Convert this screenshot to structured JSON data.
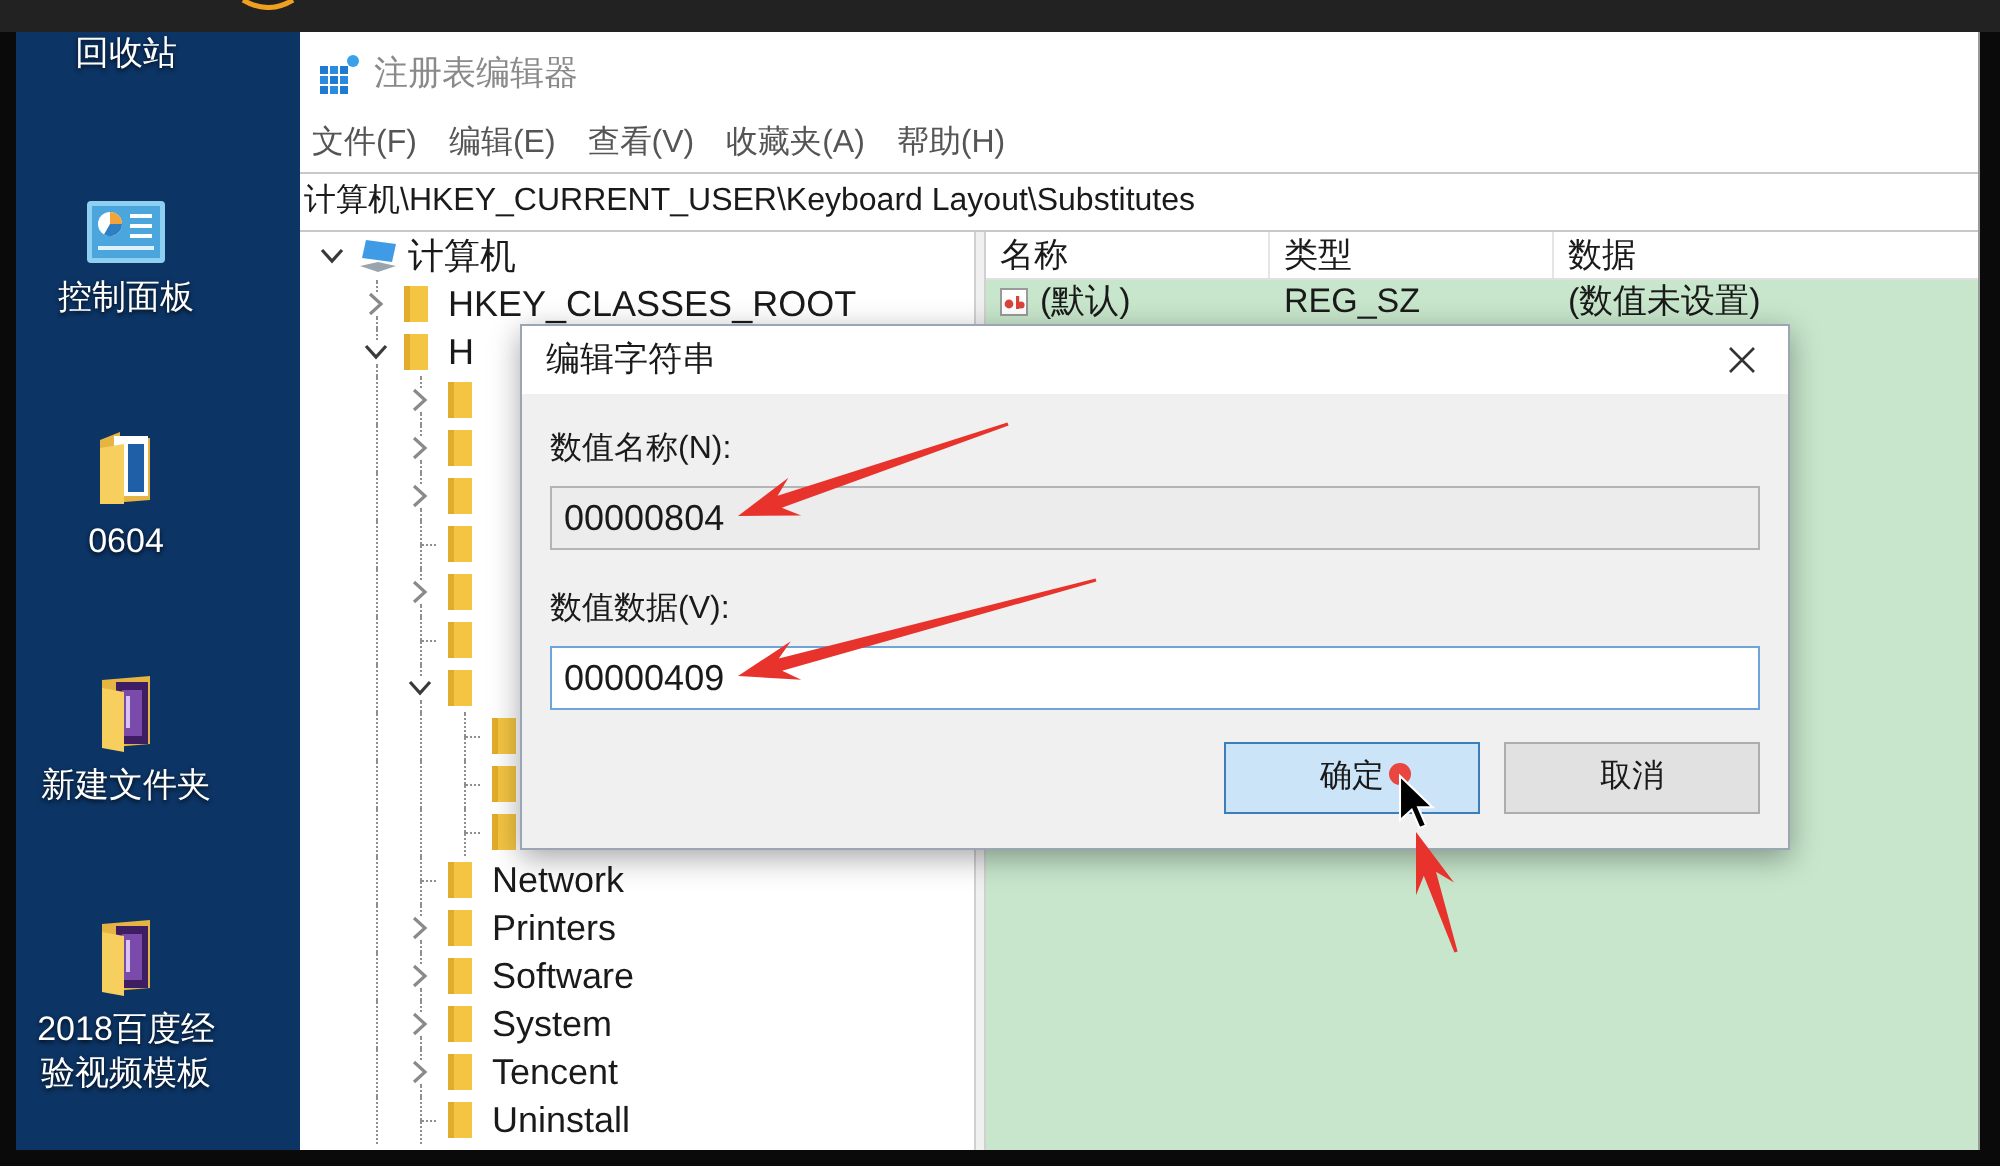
{
  "desktop": {
    "icons": [
      {
        "label": "回收站",
        "kind": "none"
      },
      {
        "label": "控制面板",
        "kind": "panel"
      },
      {
        "label": "0604",
        "kind": "document_folder"
      },
      {
        "label": "新建文件夹",
        "kind": "book_folder"
      },
      {
        "label": "2018百度经验视频模板",
        "kind": "book_folder"
      }
    ]
  },
  "window": {
    "title": "注册表编辑器",
    "menu": [
      "文件(F)",
      "编辑(E)",
      "查看(V)",
      "收藏夹(A)",
      "帮助(H)"
    ],
    "address": "计算机\\HKEY_CURRENT_USER\\Keyboard Layout\\Substitutes"
  },
  "tree": [
    {
      "label": "计算机",
      "kind": "computer",
      "expanded": true,
      "children": [
        {
          "label": "HKEY_CLASSES_ROOT",
          "kind": "folder",
          "expanded": false
        },
        {
          "label": "H",
          "kind": "folder",
          "expanded": true,
          "children": [
            {
              "kind": "folder",
              "expanded": false
            },
            {
              "kind": "folder",
              "expanded": false
            },
            {
              "kind": "folder",
              "expanded": false
            },
            {
              "kind": "leaf"
            },
            {
              "kind": "folder",
              "expanded": false
            },
            {
              "kind": "leaf"
            },
            {
              "kind": "folder",
              "expanded": true,
              "children": [
                {
                  "kind": "leaf"
                },
                {
                  "kind": "leaf"
                },
                {
                  "kind": "leaf"
                }
              ]
            },
            {
              "label": "Network",
              "kind": "leaf"
            },
            {
              "label": "Printers",
              "kind": "folder",
              "expanded": false
            },
            {
              "label": "Software",
              "kind": "folder",
              "expanded": false
            },
            {
              "label": "System",
              "kind": "folder",
              "expanded": false
            },
            {
              "label": "Tencent",
              "kind": "folder",
              "expanded": false
            },
            {
              "label": "Uninstall",
              "kind": "leaf"
            }
          ]
        }
      ]
    }
  ],
  "list": {
    "columns": [
      "名称",
      "类型",
      "数据"
    ],
    "rows": [
      {
        "name": "(默认)",
        "type": "REG_SZ",
        "data": "(数值未设置)"
      }
    ]
  },
  "dialog": {
    "title": "编辑字符串",
    "fields": [
      {
        "label": "数值名称(N):",
        "value": "00000804",
        "read_only": true,
        "focused": false
      },
      {
        "label": "数值数据(V):",
        "value": "00000409",
        "read_only": false,
        "focused": true
      }
    ],
    "buttons": [
      {
        "label": "确定",
        "default": true
      },
      {
        "label": "取消",
        "default": false
      }
    ]
  }
}
